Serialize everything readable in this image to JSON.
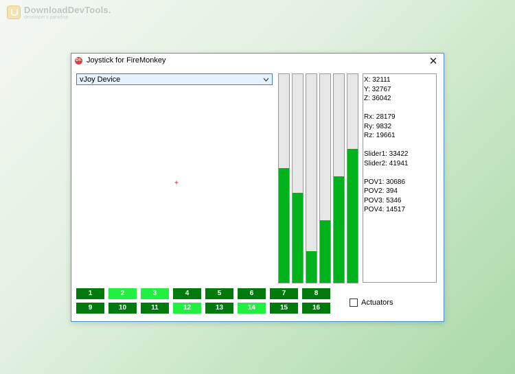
{
  "watermark": {
    "title": "DownloadDevTools.",
    "subtitle": "developer's paradise"
  },
  "window": {
    "title": "Joystick for FireMonkey",
    "icon_text": "DK",
    "close_glyph": "✕"
  },
  "device_select": {
    "value": "vJoy Device"
  },
  "axes_fill_fractions": [
    0.55,
    0.43,
    0.15,
    0.3,
    0.51,
    0.64
  ],
  "axis_color": "#00b21c",
  "readout": [
    "X: 32111",
    "Y: 32767",
    "Z: 36042",
    "",
    "Rx: 28179",
    "Ry: 9832",
    "Rz: 19661",
    "",
    "Slider1: 33422",
    "Slider2: 41941",
    "",
    "POV1: 30686",
    "POV2: 394",
    "POV3: 5346",
    "POV4: 14517"
  ],
  "buttons": [
    {
      "label": "1",
      "on": false
    },
    {
      "label": "2",
      "on": true
    },
    {
      "label": "3",
      "on": true
    },
    {
      "label": "4",
      "on": false
    },
    {
      "label": "5",
      "on": false
    },
    {
      "label": "6",
      "on": false
    },
    {
      "label": "7",
      "on": false
    },
    {
      "label": "8",
      "on": false
    },
    {
      "label": "9",
      "on": false
    },
    {
      "label": "10",
      "on": false
    },
    {
      "label": "11",
      "on": false
    },
    {
      "label": "12",
      "on": true
    },
    {
      "label": "13",
      "on": false
    },
    {
      "label": "14",
      "on": true
    },
    {
      "label": "15",
      "on": false
    },
    {
      "label": "16",
      "on": false
    }
  ],
  "actuators": {
    "label": "Actuators",
    "checked": false
  }
}
